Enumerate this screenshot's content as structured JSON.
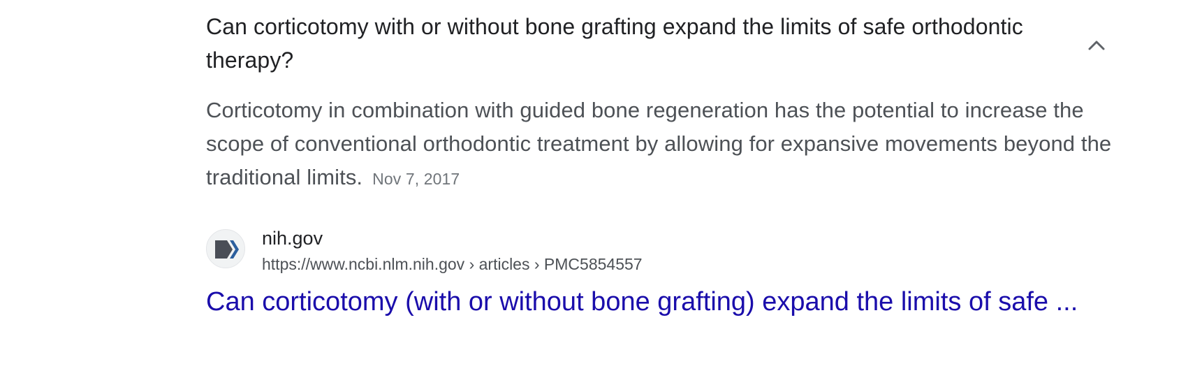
{
  "faq": {
    "question": "Can corticotomy with or without bone grafting expand the limits of safe orthodontic therapy?",
    "answer": "Corticotomy in combination with guided bone regeneration has the potential to increase the scope of conventional orthodontic treatment by allowing for expansive movements beyond the traditional limits.",
    "date": "Nov 7, 2017",
    "collapse_icon": "chevron-up-icon"
  },
  "result": {
    "site_name": "nih.gov",
    "url": "https://www.ncbi.nlm.nih.gov › articles › PMC5854557",
    "title": "Can corticotomy (with or without bone grafting) expand the limits of safe ...",
    "favicon": "nih-icon"
  },
  "colors": {
    "link": "#1a0dab",
    "text": "#202124",
    "snippet": "#4d5156",
    "favicon_dark": "#4a4e57",
    "favicon_blue": "#2c5f9e"
  }
}
